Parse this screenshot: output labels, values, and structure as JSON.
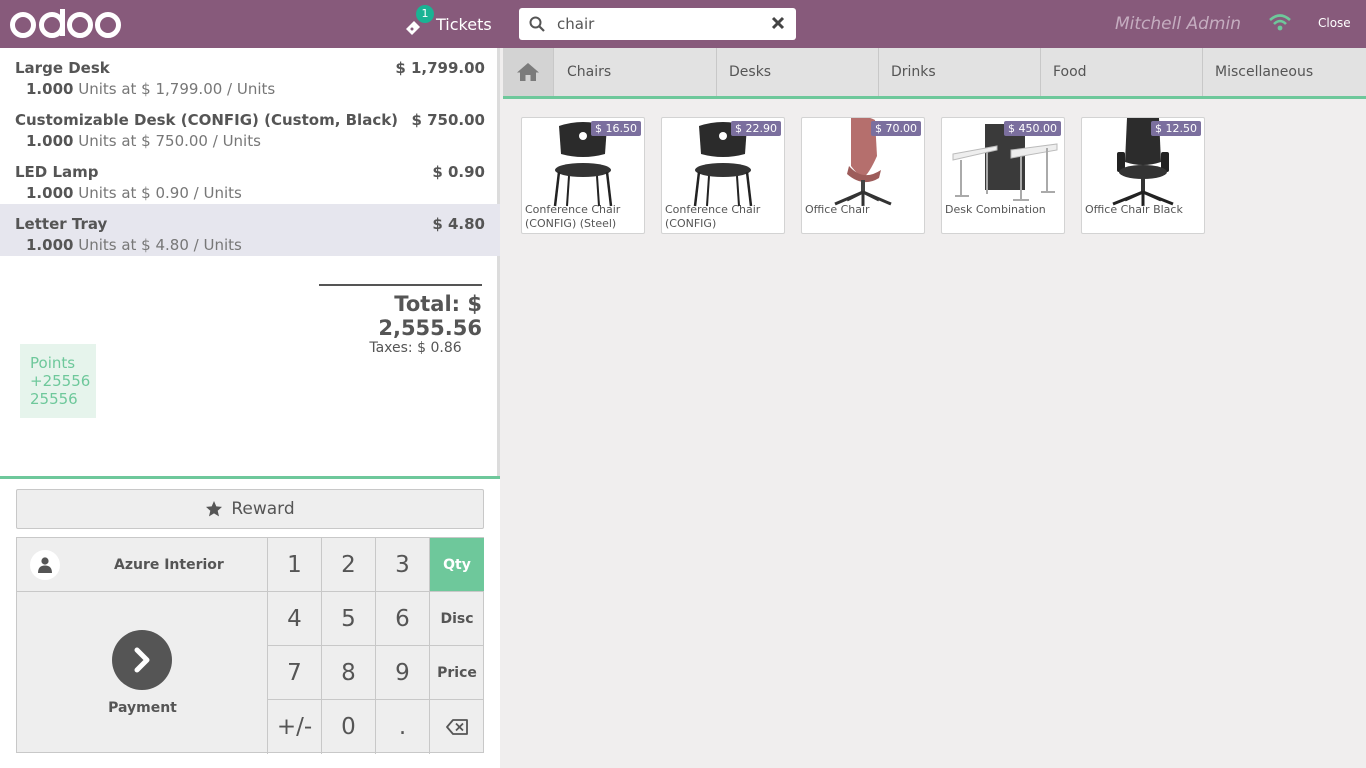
{
  "header": {
    "logo_text": "odoo",
    "tickets_label": "Tickets",
    "tickets_count": "1",
    "search_value": "chair",
    "user_name": "Mitchell Admin",
    "close_label": "Close"
  },
  "order": {
    "lines": [
      {
        "name": "Large Desk",
        "price": "$ 1,799.00",
        "qty": "1.000",
        "detail": " Units at $ 1,799.00 / Units"
      },
      {
        "name": "Customizable Desk (CONFIG) (Custom, Black)",
        "price": "$ 750.00",
        "qty": "1.000",
        "detail": " Units at $ 750.00 / Units"
      },
      {
        "name": "LED Lamp",
        "price": "$ 0.90",
        "qty": "1.000",
        "detail": " Units at $ 0.90 / Units"
      },
      {
        "name": "Letter Tray",
        "price": "$ 4.80",
        "qty": "1.000",
        "detail": " Units at $ 4.80 / Units"
      }
    ],
    "total": "Total: $ 2,555.56",
    "taxes": "Taxes: $ 0.86",
    "points": {
      "label": "Points",
      "won": "+25556",
      "total": "25556"
    }
  },
  "controls": {
    "reward_label": "Reward",
    "customer_name": "Azure Interior",
    "payment_label": "Payment",
    "keys": [
      "1",
      "2",
      "3",
      "Qty",
      "4",
      "5",
      "6",
      "Disc",
      "7",
      "8",
      "9",
      "Price",
      "+/-",
      "0",
      ".",
      "backspace-icon"
    ],
    "active_mode": "Qty"
  },
  "categories": [
    "Chairs",
    "Desks",
    "Drinks",
    "Food",
    "Miscellaneous"
  ],
  "products": [
    {
      "name": "Conference Chair (CONFIG) (Steel)",
      "price": "$ 16.50",
      "icon": "black-chair"
    },
    {
      "name": "Conference Chair (CONFIG) (Aluminium)",
      "price": "$ 22.90",
      "icon": "black-chair"
    },
    {
      "name": "Office Chair",
      "price": "$ 70.00",
      "icon": "pink-swivel-chair"
    },
    {
      "name": "Desk Combination",
      "price": "$ 450.00",
      "icon": "desk-combination"
    },
    {
      "name": "Office Chair Black",
      "price": "$ 12.50",
      "icon": "black-office-chair"
    }
  ],
  "colors": {
    "brand": "#875a7b",
    "accent": "#6ec89b",
    "price_tag": "#7b6f9e"
  }
}
